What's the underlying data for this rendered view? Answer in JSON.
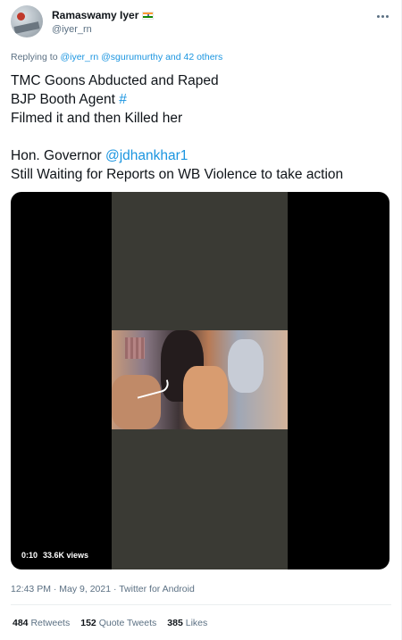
{
  "tweet": {
    "author": {
      "display_name": "Ramaswamy Iyer",
      "handle": "@iyer_rn",
      "flag": "india-flag-icon"
    },
    "reply_prefix": "Replying to",
    "reply_mentions": "@iyer_rn @sgurumurthy",
    "reply_suffix": "and 42 others",
    "text": {
      "line1": "TMC Goons Abducted and Raped",
      "line2_prefix": "BJP Booth Agent",
      "line2_hashtag": "#",
      "line3": "Filmed it and then Killed her",
      "line5_prefix": "Hon. Governor",
      "line5_mention": "@jdhankhar1",
      "line6": "Still Waiting for Reports on WB Violence to take action"
    },
    "video": {
      "duration": "0:10",
      "views": "33.6K views"
    },
    "meta": "12:43 PM · May 9, 2021 · Twitter for Android",
    "stats": {
      "retweets_count": "484",
      "retweets_label": "Retweets",
      "quotes_count": "152",
      "quotes_label": "Quote Tweets",
      "likes_count": "385",
      "likes_label": "Likes"
    }
  },
  "colors": {
    "link": "#1b95e0",
    "secondary_text": "#5b7083",
    "primary_text": "#0f1419"
  }
}
